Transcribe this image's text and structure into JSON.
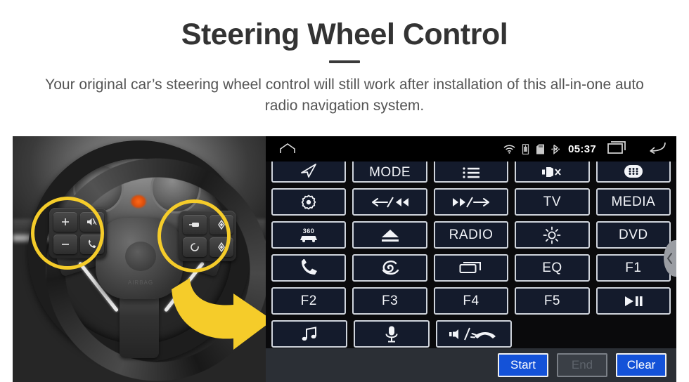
{
  "header": {
    "title": "Steering Wheel Control",
    "subtitle": "Your original car’s steering wheel control will still work after installation of this all-in-one auto radio navigation system."
  },
  "photo": {
    "alt_name": "steering-wheel-photo",
    "highlight_color": "#f5cc2a",
    "arrow_color": "#f5cc2a",
    "left_cluster": {
      "name": "left-steering-controls",
      "keys": [
        "volume-up",
        "volume-down",
        "mute",
        "phone-call"
      ]
    },
    "right_cluster": {
      "name": "right-steering-controls",
      "keys": [
        "media-source",
        "seek-up",
        "voice-circle",
        "seek-down"
      ]
    }
  },
  "unit": {
    "statusbar": {
      "home_icon": "home-icon",
      "icons": [
        "wifi-icon",
        "usb-icon",
        "sdcard-icon",
        "bluetooth-icon"
      ],
      "clock": "05:37",
      "recents_icon": "recents-icon",
      "back_icon": "back-icon"
    },
    "colors": {
      "panel_bg": "#0a0a0c",
      "button_fill": "#141b2c",
      "button_border": "#cfd4dc",
      "accent_blue": "#1452d8",
      "actionbar_bg": "#2b2f35"
    },
    "button_rows": [
      [
        {
          "label": "",
          "icon": "navigation-arrow-icon"
        },
        {
          "label": "MODE",
          "icon": ""
        },
        {
          "label": "",
          "icon": "list-icon"
        },
        {
          "label": "",
          "icon": "mute-icon"
        },
        {
          "label": "",
          "icon": "apps-grid-icon"
        }
      ],
      [
        {
          "label": "",
          "icon": "settings-gear-icon"
        },
        {
          "label": "",
          "icon": "previous-track-icon"
        },
        {
          "label": "",
          "icon": "next-track-icon"
        },
        {
          "label": "TV",
          "icon": ""
        },
        {
          "label": "MEDIA",
          "icon": ""
        }
      ],
      [
        {
          "label": "",
          "icon": "camera-360-icon"
        },
        {
          "label": "",
          "icon": "eject-icon"
        },
        {
          "label": "RADIO",
          "icon": ""
        },
        {
          "label": "",
          "icon": "brightness-icon"
        },
        {
          "label": "DVD",
          "icon": ""
        }
      ],
      [
        {
          "label": "",
          "icon": "phone-icon"
        },
        {
          "label": "",
          "icon": "swirl-icon"
        },
        {
          "label": "",
          "icon": "screen-icon"
        },
        {
          "label": "EQ",
          "icon": ""
        },
        {
          "label": "F1",
          "icon": ""
        }
      ],
      [
        {
          "label": "F2",
          "icon": ""
        },
        {
          "label": "F3",
          "icon": ""
        },
        {
          "label": "F4",
          "icon": ""
        },
        {
          "label": "F5",
          "icon": ""
        },
        {
          "label": "",
          "icon": "play-pause-icon"
        }
      ],
      [
        {
          "label": "",
          "icon": "music-note-icon"
        },
        {
          "label": "",
          "icon": "microphone-icon"
        },
        {
          "label": "",
          "icon": "speaker-hangup-icon"
        }
      ]
    ],
    "actions": {
      "start": "Start",
      "end": "End",
      "clear": "Clear",
      "end_disabled": true
    },
    "scroll_handle": "scroll-handle-icon"
  }
}
